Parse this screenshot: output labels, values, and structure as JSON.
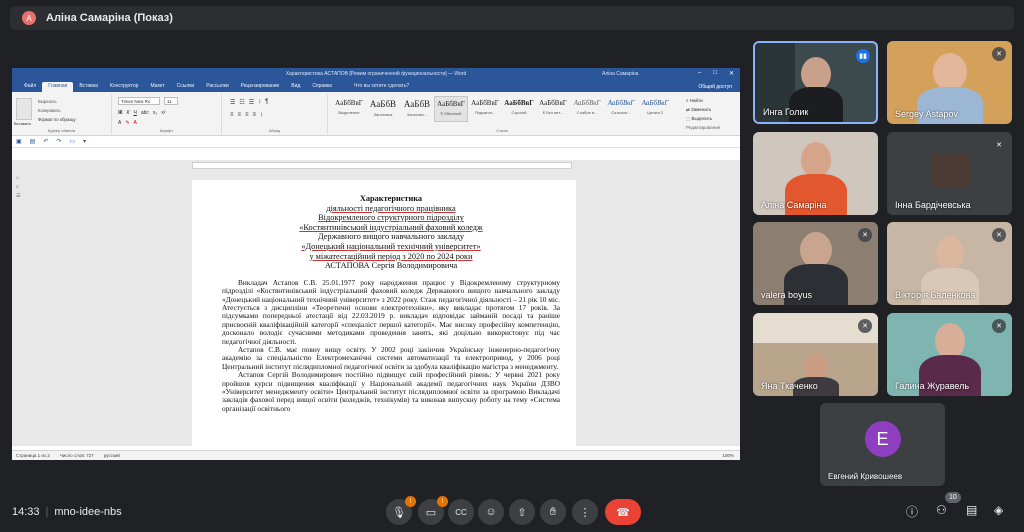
{
  "presenter": {
    "avatar_letter": "A",
    "label": "Аліна Самаріна (Показ)"
  },
  "word": {
    "title": "Характеристика АСТАПОВ [Режим ограниченной функциональности] — Word",
    "user": "Аліна Самаріна",
    "tabs": [
      "Файл",
      "Главная",
      "Вставка",
      "Конструктор",
      "Макет",
      "Ссылки",
      "Рассылки",
      "Рецензирование",
      "Вид",
      "Справка"
    ],
    "tell_me": "Что вы хотите сделать?",
    "share": "Общий доступ",
    "ribbon": {
      "paste": "Вставить",
      "cut": "Вырезать",
      "copy": "Копировать",
      "format_painter": "Формат по образцу",
      "font_name": "Times New Ro",
      "font_size": "11",
      "clipboard_label": "Буфер обмена",
      "font_label": "Шрифт",
      "paragraph_label": "Абзац",
      "styles_label": "Стили",
      "editing_label": "Редактирование",
      "find": "Найти",
      "replace": "Заменить",
      "select": "Выделить"
    },
    "styles": [
      {
        "sample": "АаБбВвГ",
        "name": "Выделение"
      },
      {
        "sample": "АаБбВ",
        "name": "Заголовок"
      },
      {
        "sample": "АаБбВ",
        "name": "Заголово..."
      },
      {
        "sample": "АаБбВвГ",
        "name": "¶ Обычный"
      },
      {
        "sample": "АаБбВвГ",
        "name": "Подзагол..."
      },
      {
        "sample": "АаБбВвГ",
        "name": "Строгий"
      },
      {
        "sample": "АаБбВвГ",
        "name": "¶ Без инт..."
      },
      {
        "sample": "АаБбВвГ",
        "name": "Слабое в..."
      },
      {
        "sample": "АаБбВвГ",
        "name": "Сильное..."
      },
      {
        "sample": "АаБбВвГ",
        "name": "Цитата 2"
      }
    ],
    "document": {
      "heading": "Характеристика",
      "title_lines": [
        "діяльності педагогічного працівника",
        "Відокремленого структурного підрозділу",
        "«Костянтинівський індустріальний фаховий коледж",
        "Державного вищого навчального закладу",
        "«Донецький національний технічний університет»",
        "у міжатестаційний період з 2020 по 2024 роки",
        "АСТАПОВА Сергія Володимировича"
      ],
      "paragraphs": [
        "Викладач Астапов С.В. 25.01.1977 року народження працює у Відокремленому структурному підрозділі «Костянтинівський індустріальний фаховий коледж Державного вищого навчального закладу «Донецький національний технічний університет» з 2022 року. Стаж педагогічної діяльності – 21 рік 10 міс. Атестується з дисципліни «Теоретичні основи електротехніки», яку викладає протягом 17 років. За підсумками попередньої атестації від 22.03.2019 р. викладач відповідає займаній посаді та раніше присвоєній кваліфікаційній категорії «спеціаліст першої категорії». Має високу професійну компетенцію, досконало володіє сучасними методиками проведення занять, які доцільно використовує під час педагогічної діяльності.",
        "Астапов С.В. має повну вищу освіту. У 2002 році закінчив Українську інженерно-педагогічну академію за спеціальністю Електромеханічні системи автоматизації та електропривод, у 2006 році Центральний інститут післядипломної педагогічної освіти за здобула кваліфікацію магістра з менеджменту.",
        "Астапов Сергій Володимирович постійно підвищує свій професійний рівень: У червні 2021 року пройшов курси підвищення кваліфікації у Національній академії педагогічних наук України ДЗВО «Університет менеджменту освіти» Центральний інститут післядипломної освіти за програмою Викладачі закладів фахової перед вищої освіти (коледжів, технікумів) та виконав випускну роботу на тему «Система організації освітнього"
      ]
    },
    "status": {
      "page": "Страница 1 из 2",
      "words": "Число слов: 727",
      "lang": "русский",
      "zoom": "100%"
    }
  },
  "participants": [
    {
      "name": "Инга Голик",
      "active": true
    },
    {
      "name": "Sergey Astapov",
      "active": false
    },
    {
      "name": "Аліна Самаріна",
      "active": false
    },
    {
      "name": "Інна Бардічевська",
      "active": false
    },
    {
      "name": "valera boyus",
      "active": false
    },
    {
      "name": "Вікторія Баленкова",
      "active": false
    },
    {
      "name": "Яна Ткаченко",
      "active": false
    },
    {
      "name": "Галина Журавель",
      "active": false
    },
    {
      "name": "Евгений Кривошеев",
      "avatar_letter": "E",
      "active": false
    }
  ],
  "bottom_bar": {
    "time": "14:33",
    "meeting_code": "mno-idee-nbs",
    "mic_badge": "!",
    "cam_badge": "!",
    "participant_count": "10"
  },
  "colors": {
    "word_blue": "#2b579a",
    "end_call_red": "#ea4335",
    "avatar_purple": "#8e3fbf"
  }
}
